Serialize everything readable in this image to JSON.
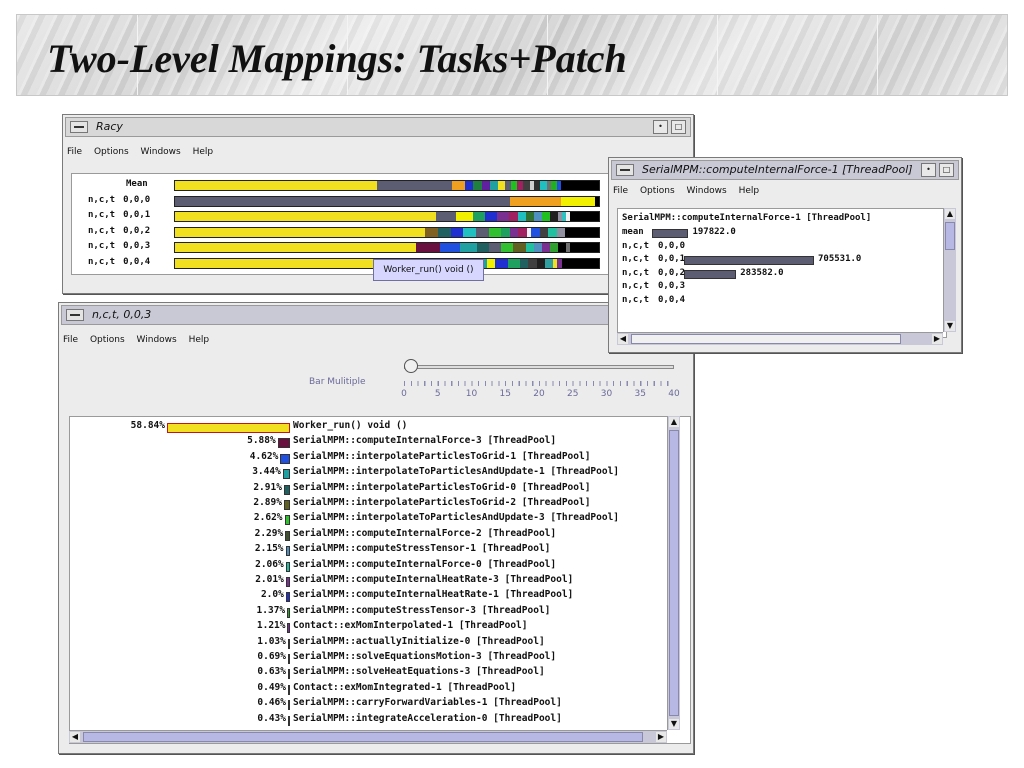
{
  "slide": {
    "title": "Two-Level Mappings: Tasks+Patch"
  },
  "racy_window": {
    "title": "Racy",
    "menu": [
      "File",
      "Options",
      "Windows",
      "Help"
    ],
    "rows": [
      {
        "label": "",
        "value": "Mean",
        "segments": [
          [
            "#f0e020",
            0.48
          ],
          [
            "#5c5c72",
            0.18
          ],
          [
            "#f0a020",
            0.03
          ],
          [
            "#2030d0",
            0.02
          ],
          [
            "#208040",
            0.02
          ],
          [
            "#6020a0",
            0.02
          ],
          [
            "#20a0a0",
            0.02
          ],
          [
            "#f0e020",
            0.015
          ],
          [
            "#5c5c72",
            0.015
          ],
          [
            "#20c020",
            0.015
          ],
          [
            "#a02060",
            0.015
          ],
          [
            "#404040",
            0.015
          ],
          [
            "#d0d0d0",
            0.01
          ],
          [
            "#303030",
            0.015
          ],
          [
            "#20c0c0",
            0.015
          ],
          [
            "#707070",
            0.01
          ],
          [
            "#20b020",
            0.015
          ],
          [
            "#2050e0",
            0.01
          ],
          [
            "#000000",
            0.09
          ]
        ]
      },
      {
        "label": "n,c,t",
        "value": "0,0,0",
        "segments": [
          [
            "#5c5c72",
            0.79
          ],
          [
            "#f0a020",
            0.12
          ],
          [
            "#f0f000",
            0.08
          ],
          [
            "#000000",
            0.01
          ]
        ]
      },
      {
        "label": "n,c,t",
        "value": "0,0,1",
        "segments": [
          [
            "#f0e020",
            0.64
          ],
          [
            "#5c5c72",
            0.05
          ],
          [
            "#f0f000",
            0.04
          ],
          [
            "#20a060",
            0.03
          ],
          [
            "#2030d0",
            0.03
          ],
          [
            "#7a3090",
            0.03
          ],
          [
            "#a02060",
            0.02
          ],
          [
            "#20c0c0",
            0.02
          ],
          [
            "#307030",
            0.02
          ],
          [
            "#5090c0",
            0.02
          ],
          [
            "#20c020",
            0.02
          ],
          [
            "#202020",
            0.02
          ],
          [
            "#9090a0",
            0.01
          ],
          [
            "#30c0c0",
            0.01
          ],
          [
            "#f0f0f0",
            0.01
          ],
          [
            "#000000",
            0.07
          ]
        ]
      },
      {
        "label": "n,c,t",
        "value": "0,0,2",
        "segments": [
          [
            "#f0e020",
            0.59
          ],
          [
            "#806020",
            0.03
          ],
          [
            "#206060",
            0.03
          ],
          [
            "#2030d0",
            0.03
          ],
          [
            "#20c0c0",
            0.03
          ],
          [
            "#5c5c72",
            0.03
          ],
          [
            "#30c030",
            0.03
          ],
          [
            "#20a060",
            0.02
          ],
          [
            "#7a3090",
            0.02
          ],
          [
            "#a02060",
            0.02
          ],
          [
            "#f0f0f0",
            0.01
          ],
          [
            "#2050e0",
            0.02
          ],
          [
            "#404040",
            0.02
          ],
          [
            "#20c0a0",
            0.02
          ],
          [
            "#9090a0",
            0.02
          ],
          [
            "#000000",
            0.08
          ]
        ]
      },
      {
        "label": "n,c,t",
        "value": "0,0,3",
        "segments": [
          [
            "#f0e020",
            0.59
          ],
          [
            "#6a1040",
            0.06
          ],
          [
            "#2050e0",
            0.05
          ],
          [
            "#20a0a0",
            0.04
          ],
          [
            "#206060",
            0.03
          ],
          [
            "#5c5c72",
            0.03
          ],
          [
            "#30c030",
            0.03
          ],
          [
            "#606020",
            0.03
          ],
          [
            "#20c0a0",
            0.02
          ],
          [
            "#5090c0",
            0.02
          ],
          [
            "#7a3090",
            0.02
          ],
          [
            "#30a030",
            0.02
          ],
          [
            "#000000",
            0.02
          ],
          [
            "#707070",
            0.01
          ],
          [
            "#000000",
            0.07
          ]
        ]
      },
      {
        "label": "n,c,t",
        "value": "0,0,4",
        "segments": [
          [
            "#f0e020",
            0.6
          ],
          [
            "#5c5c72",
            0.08
          ],
          [
            "#307030",
            0.04
          ],
          [
            "#20a0a0",
            0.03
          ],
          [
            "#f0f000",
            0.02
          ],
          [
            "#2030d0",
            0.03
          ],
          [
            "#20a060",
            0.03
          ],
          [
            "#206060",
            0.02
          ],
          [
            "#404040",
            0.02
          ],
          [
            "#202020",
            0.02
          ],
          [
            "#30a0a0",
            0.02
          ],
          [
            "#f0e020",
            0.01
          ],
          [
            "#7a3090",
            0.01
          ],
          [
            "#000000",
            0.09
          ]
        ]
      }
    ],
    "tooltip": "Worker_run() void ()"
  },
  "thread_window": {
    "title": "n,c,t, 0,0,3",
    "menu": [
      "File",
      "Options",
      "Windows",
      "Help"
    ],
    "slider_label": "Bar Mulitiple",
    "slider_ticks": [
      "0",
      "5",
      "10",
      "15",
      "20",
      "25",
      "30",
      "35",
      "40"
    ],
    "rows": [
      {
        "pct": "58.84%",
        "color": "#f0e020",
        "name": "Worker_run() void ()"
      },
      {
        "pct": "5.88%",
        "color": "#6a1040",
        "name": "SerialMPM::computeInternalForce-3 [ThreadPool]"
      },
      {
        "pct": "4.62%",
        "color": "#2050e0",
        "name": "SerialMPM::interpolateParticlesToGrid-1 [ThreadPool]"
      },
      {
        "pct": "3.44%",
        "color": "#20a0a0",
        "name": "SerialMPM::interpolateToParticlesAndUpdate-1 [ThreadPool]"
      },
      {
        "pct": "2.91%",
        "color": "#206060",
        "name": "SerialMPM::interpolateParticlesToGrid-0 [ThreadPool]"
      },
      {
        "pct": "2.89%",
        "color": "#606020",
        "name": "SerialMPM::interpolateParticlesToGrid-2 [ThreadPool]"
      },
      {
        "pct": "2.62%",
        "color": "#30c030",
        "name": "SerialMPM::interpolateToParticlesAndUpdate-3 [ThreadPool]"
      },
      {
        "pct": "2.29%",
        "color": "#405030",
        "name": "SerialMPM::computeInternalForce-2 [ThreadPool]"
      },
      {
        "pct": "2.15%",
        "color": "#5090c0",
        "name": "SerialMPM::computeStressTensor-1 [ThreadPool]"
      },
      {
        "pct": "2.06%",
        "color": "#20c0a0",
        "name": "SerialMPM::computeInternalForce-0 [ThreadPool]"
      },
      {
        "pct": "2.01%",
        "color": "#7a3090",
        "name": "SerialMPM::computeInternalHeatRate-3 [ThreadPool]"
      },
      {
        "pct": "2.0%",
        "color": "#2030d0",
        "name": "SerialMPM::computeInternalHeatRate-1 [ThreadPool]"
      },
      {
        "pct": "1.37%",
        "color": "#30a030",
        "name": "SerialMPM::computeStressTensor-3 [ThreadPool]"
      },
      {
        "pct": "1.21%",
        "color": "#7a3090",
        "name": "Contact::exMomInterpolated-1 [ThreadPool]"
      },
      {
        "pct": "1.03%",
        "color": "#20a0c0",
        "name": "SerialMPM::actuallyInitialize-0 [ThreadPool]"
      },
      {
        "pct": "0.69%",
        "color": "#404040",
        "name": "SerialMPM::solveEquationsMotion-3 [ThreadPool]"
      },
      {
        "pct": "0.63%",
        "color": "#80c080",
        "name": "SerialMPM::solveHeatEquations-3 [ThreadPool]"
      },
      {
        "pct": "0.49%",
        "color": "#606060",
        "name": "Contact::exMomIntegrated-1 [ThreadPool]"
      },
      {
        "pct": "0.46%",
        "color": "#a0a0a0",
        "name": "SerialMPM::carryForwardVariables-1 [ThreadPool]"
      },
      {
        "pct": "0.43%",
        "color": "#c0c0c0",
        "name": "SerialMPM::integrateAcceleration-0 [ThreadPool]"
      }
    ]
  },
  "mpm_window": {
    "title": "SerialMPM::computeInternalForce-1 [ThreadPool]",
    "menu": [
      "File",
      "Options",
      "Windows",
      "Help"
    ],
    "heading": "SerialMPM::computeInternalForce-1 [ThreadPool]",
    "rows": [
      {
        "label": "mean",
        "value": "",
        "amount": 197822.0,
        "text": "197822.0"
      },
      {
        "label": "n,c,t",
        "value": "0,0,0",
        "amount": 0,
        "text": ""
      },
      {
        "label": "n,c,t",
        "value": "0,0,1",
        "amount": 705531.0,
        "text": "705531.0"
      },
      {
        "label": "n,c,t",
        "value": "0,0,2",
        "amount": 283582.0,
        "text": "283582.0"
      },
      {
        "label": "n,c,t",
        "value": "0,0,3",
        "amount": 0,
        "text": ""
      },
      {
        "label": "n,c,t",
        "value": "0,0,4",
        "amount": 0,
        "text": ""
      }
    ]
  }
}
